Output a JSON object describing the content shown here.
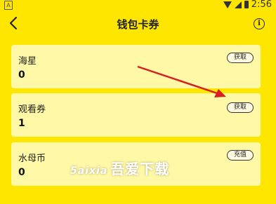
{
  "status_bar": {
    "notification_icon": "A",
    "time": "2:56"
  },
  "header": {
    "title": "钱包卡券",
    "back_icon": "chevron-left",
    "info_icon": "i"
  },
  "cards": [
    {
      "name": "海星",
      "value": "0",
      "button": "获取"
    },
    {
      "name": "观看券",
      "value": "1",
      "button": "获取"
    },
    {
      "name": "水母币",
      "value": "0",
      "button": "充值"
    }
  ],
  "watermark": {
    "latin": "5aixia",
    "text": "吾爱下载"
  },
  "colors": {
    "background": "#ffe600",
    "card": "#fff8a6",
    "arrow": "#d42020"
  }
}
